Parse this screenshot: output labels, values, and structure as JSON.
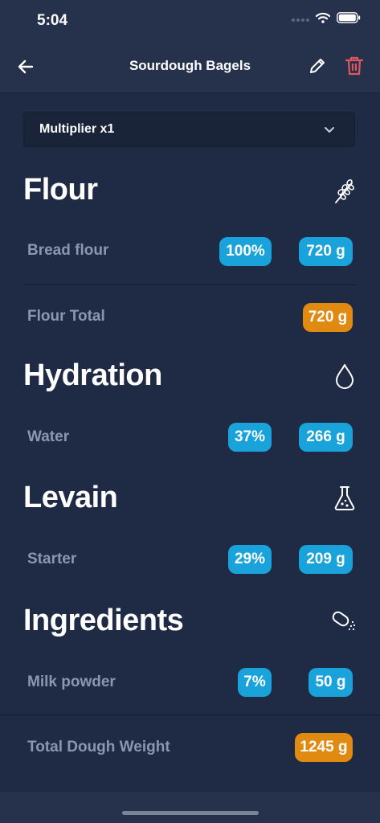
{
  "status": {
    "time": "5:04",
    "icons": [
      "signal-icon",
      "wifi-icon",
      "battery-icon"
    ]
  },
  "nav": {
    "title": "Sourdough Bagels",
    "back_icon": "arrow-left-icon",
    "edit_icon": "pencil-icon",
    "delete_icon": "trash-icon",
    "delete_color": "#e0565d"
  },
  "multiplier": {
    "label": "Multiplier x1",
    "icon": "chevron-down-icon"
  },
  "sections": {
    "flour": {
      "title": "Flour",
      "icon": "wheat-icon",
      "rows": [
        {
          "label": "Bread flour",
          "percent": "100%",
          "weight": "720 g"
        }
      ],
      "total_label": "Flour Total",
      "total_weight": "720 g"
    },
    "hydration": {
      "title": "Hydration",
      "icon": "water-drop-icon",
      "rows": [
        {
          "label": "Water",
          "percent": "37%",
          "weight": "266 g"
        }
      ]
    },
    "levain": {
      "title": "Levain",
      "icon": "flask-icon",
      "rows": [
        {
          "label": "Starter",
          "percent": "29%",
          "weight": "209 g"
        }
      ]
    },
    "ingredients": {
      "title": "Ingredients",
      "icon": "salt-shaker-icon",
      "rows": [
        {
          "label": "Milk powder",
          "percent": "7%",
          "weight": "50 g"
        }
      ]
    }
  },
  "total": {
    "label": "Total Dough Weight",
    "weight": "1245 g"
  },
  "colors": {
    "background": "#1f2b45",
    "bar": "#26324c",
    "pill_blue": "#1aa3db",
    "pill_orange": "#e08a12",
    "label_gray": "#8b97b0"
  }
}
